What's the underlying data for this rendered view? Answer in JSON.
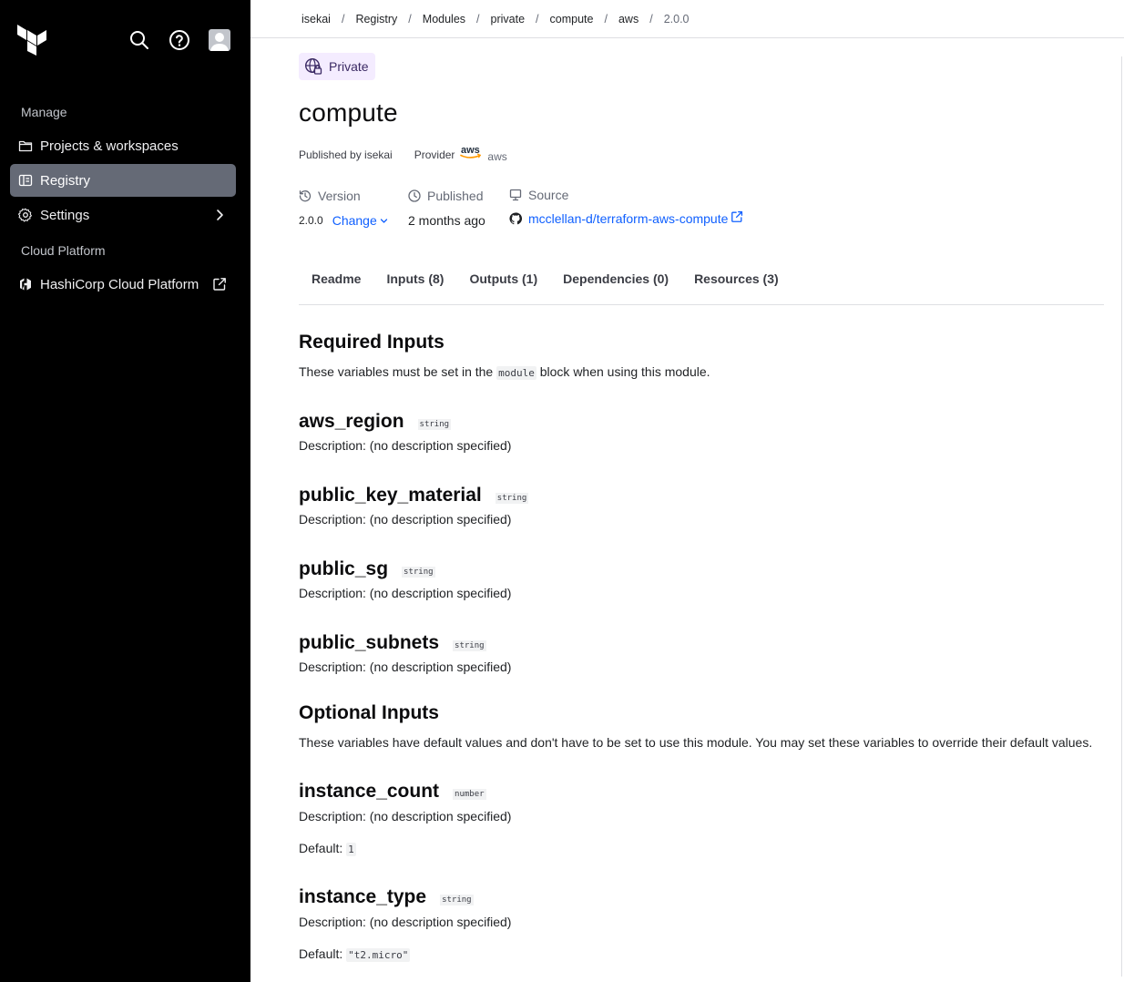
{
  "sidebar": {
    "sections": {
      "manage": "Manage",
      "cloud_platform": "Cloud Platform"
    },
    "items": [
      {
        "label": "Projects & workspaces",
        "icon": "folder-icon"
      },
      {
        "label": "Registry",
        "icon": "registry-icon",
        "active": true
      },
      {
        "label": "Settings",
        "icon": "gear-icon"
      },
      {
        "label": "HashiCorp Cloud Platform",
        "icon": "hashicorp-icon"
      }
    ]
  },
  "breadcrumb": [
    "isekai",
    "Registry",
    "Modules",
    "private",
    "compute",
    "aws",
    "2.0.0"
  ],
  "module": {
    "visibility": "Private",
    "name": "compute",
    "published_by": "Published by isekai",
    "provider_label": "Provider",
    "provider_logo_text": "aws",
    "provider": "aws",
    "version_label": "Version",
    "version": "2.0.0",
    "change_label": "Change",
    "published_label": "Published",
    "published": "2 months ago",
    "source_label": "Source",
    "source": "mcclellan-d/terraform-aws-compute"
  },
  "tabs": [
    "Readme",
    "Inputs (8)",
    "Outputs (1)",
    "Dependencies (0)",
    "Resources (3)"
  ],
  "required": {
    "title": "Required Inputs",
    "intro_before": "These variables must be set in the ",
    "intro_code": "module",
    "intro_after": " block when using this module.",
    "vars": [
      {
        "name": "aws_region",
        "type": "string",
        "desc": "Description: (no description specified)"
      },
      {
        "name": "public_key_material",
        "type": "string",
        "desc": "Description: (no description specified)"
      },
      {
        "name": "public_sg",
        "type": "string",
        "desc": "Description: (no description specified)"
      },
      {
        "name": "public_subnets",
        "type": "string",
        "desc": "Description: (no description specified)"
      }
    ]
  },
  "optional": {
    "title": "Optional Inputs",
    "intro": "These variables have default values and don't have to be set to use this module. You may set these variables to override their default values.",
    "default_label": "Default:",
    "vars": [
      {
        "name": "instance_count",
        "type": "number",
        "desc": "Description: (no description specified)",
        "default": "1"
      },
      {
        "name": "instance_type",
        "type": "string",
        "desc": "Description: (no description specified)",
        "default": "\"t2.micro\""
      }
    ]
  },
  "colors": {
    "sidebar_bg": "#000000",
    "active_item": "#656a76",
    "link": "#1060ff",
    "private_badge_bg": "#f4ecff"
  }
}
